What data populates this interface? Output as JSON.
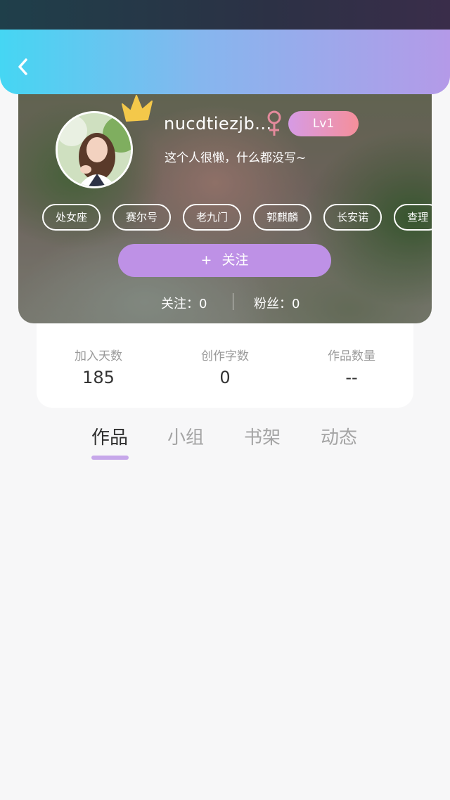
{
  "header": {
    "back_icon": "chevron-left-icon"
  },
  "profile": {
    "username": "nucdtiezjb...",
    "gender_icon": "female-symbol-icon",
    "gender_color": "#e48a9c",
    "level": "Lv1",
    "bio": "这个人很懒，什么都没写~",
    "crown_icon": "crown-icon",
    "tags": [
      "处女座",
      "赛尔号",
      "老九门",
      "郭麒麟",
      "长安诺",
      "查理"
    ],
    "follow_button": {
      "plus": "+",
      "label": "关注"
    },
    "following": "关注：0",
    "fans": "粉丝：0"
  },
  "stats": [
    {
      "label": "加入天数",
      "value": "185"
    },
    {
      "label": "创作字数",
      "value": "0"
    },
    {
      "label": "作品数量",
      "value": "--"
    }
  ],
  "tabs": [
    {
      "label": "作品",
      "active": true
    },
    {
      "label": "小组",
      "active": false
    },
    {
      "label": "书架",
      "active": false
    },
    {
      "label": "动态",
      "active": false
    }
  ],
  "colors": {
    "accent": "#be91e6",
    "tab_indicator": "#c6a7ea",
    "header_gradient_start": "#45d6f3",
    "header_gradient_end": "#b49ae8"
  }
}
